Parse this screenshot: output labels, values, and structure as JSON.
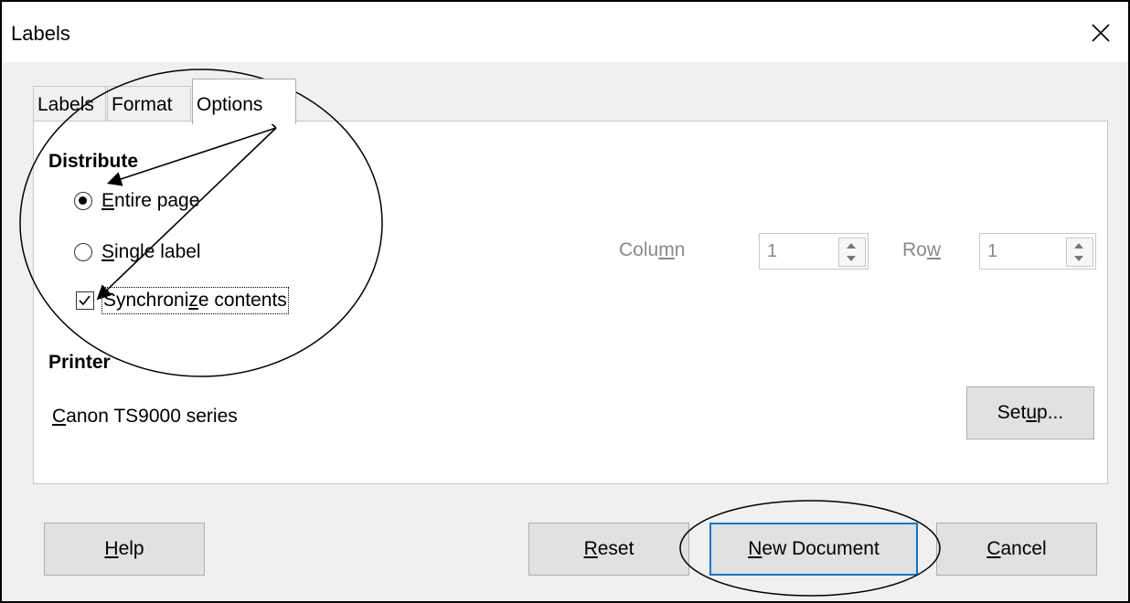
{
  "window": {
    "title": "Labels",
    "close_glyph": "✕"
  },
  "tabs": [
    {
      "label": "Labels",
      "active": false
    },
    {
      "label": "Format",
      "active": false
    },
    {
      "label": "Options",
      "active": true
    }
  ],
  "distribute": {
    "heading": "Distribute",
    "entire_page": {
      "pre": "",
      "mnemonic": "E",
      "post": "ntire page",
      "selected": true
    },
    "single_label": {
      "pre": "",
      "mnemonic": "S",
      "post": "ingle label",
      "selected": false
    },
    "sync": {
      "pre": "Synchroni",
      "mnemonic": "z",
      "post": "e contents",
      "checked": true
    }
  },
  "column": {
    "pre": "Colu",
    "mnemonic": "m",
    "post": "n",
    "value": "1"
  },
  "row": {
    "pre": "Ro",
    "mnemonic": "w",
    "post": "",
    "value": "1"
  },
  "printer": {
    "heading": "Printer",
    "name_mnemonic": "C",
    "name_rest": "anon TS9000 series",
    "setup": {
      "pre": "Set",
      "mnemonic": "u",
      "post": "p..."
    }
  },
  "buttons": {
    "help": {
      "pre": "",
      "mnemonic": "H",
      "post": "elp"
    },
    "reset": {
      "pre": "",
      "mnemonic": "R",
      "post": "eset"
    },
    "new_document": {
      "pre": "",
      "mnemonic": "N",
      "post": "ew Document"
    },
    "cancel": {
      "pre": "",
      "mnemonic": "C",
      "post": "ancel"
    }
  },
  "colors": {
    "accent": "#0078d7",
    "disabled": "#8a8a8a",
    "panel": "#ffffff",
    "window": "#f0f0f0"
  }
}
